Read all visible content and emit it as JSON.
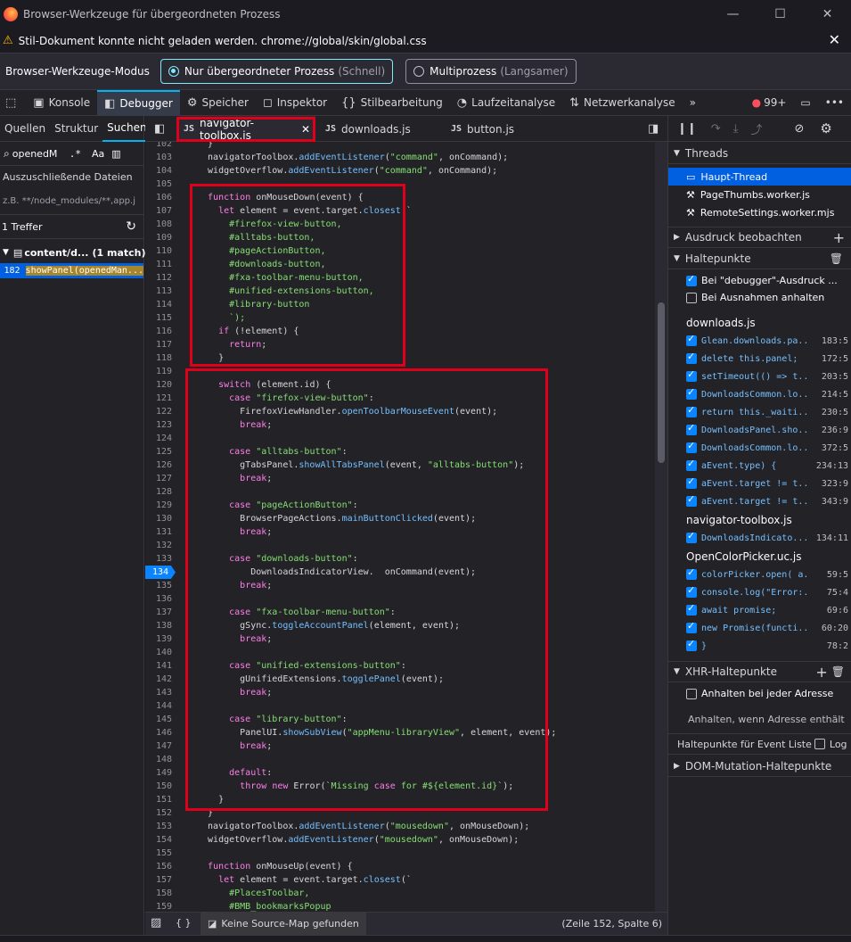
{
  "window": {
    "title": "Browser-Werkzeuge für übergeordneten Prozess",
    "minimize": "—",
    "maximize": "☐",
    "close": "✕"
  },
  "notification": {
    "text": "Stil-Dokument konnte nicht geladen werden. chrome://global/skin/global.css",
    "close": "✕"
  },
  "mode": {
    "label": "Browser-Werkzeuge-Modus",
    "option1": "Nur übergeordneter Prozess",
    "option1_hint": "(Schnell)",
    "option2": "Multiprozess",
    "option2_hint": "(Langsamer)"
  },
  "toolbox": {
    "tabs": [
      "Konsole",
      "Debugger",
      "Speicher",
      "Inspektor",
      "Stilbearbeitung",
      "Laufzeitanalyse",
      "Netzwerkanalyse"
    ],
    "more": "»",
    "errors": "99+",
    "menu": "•••"
  },
  "left": {
    "tabs": [
      "Quellen",
      "Struktur",
      "Suchen"
    ],
    "search_value": "openedM",
    "regex": ".*",
    "case": "Aa",
    "excluded_label": "Auszuschließende Dateien",
    "excluded_placeholder": "z.B. **/node_modules/**,app.j",
    "hits": "1 Treffer",
    "result_file": "content/d...",
    "result_match": "(1 match)",
    "result_line": "182",
    "result_text": "showPanel(openedMan..."
  },
  "editor": {
    "tabs": [
      "navigator-toolbox.js",
      "downloads.js",
      "button.js"
    ],
    "js_badge": "JS",
    "tab_close": "✕",
    "current_line": "134",
    "lines": [
      {
        "n": "102",
        "t": "  }"
      },
      {
        "n": "103",
        "t": "  navigatorToolbox.addEventListener(\"command\", onCommand);"
      },
      {
        "n": "104",
        "t": "  widgetOverflow.addEventListener(\"command\", onCommand);"
      },
      {
        "n": "105",
        "t": ""
      },
      {
        "n": "106",
        "t": "  function onMouseDown(event) {"
      },
      {
        "n": "107",
        "t": "    let element = event.target.closest(`"
      },
      {
        "n": "108",
        "t": "      #firefox-view-button,"
      },
      {
        "n": "109",
        "t": "      #alltabs-button,"
      },
      {
        "n": "110",
        "t": "      #pageActionButton,"
      },
      {
        "n": "111",
        "t": "      #downloads-button,"
      },
      {
        "n": "112",
        "t": "      #fxa-toolbar-menu-button,"
      },
      {
        "n": "113",
        "t": "      #unified-extensions-button,"
      },
      {
        "n": "114",
        "t": "      #library-button"
      },
      {
        "n": "115",
        "t": "      `);"
      },
      {
        "n": "116",
        "t": "    if (!element) {"
      },
      {
        "n": "117",
        "t": "      return;"
      },
      {
        "n": "118",
        "t": "    }"
      },
      {
        "n": "119",
        "t": ""
      },
      {
        "n": "120",
        "t": "    switch (element.id) {"
      },
      {
        "n": "121",
        "t": "      case \"firefox-view-button\":"
      },
      {
        "n": "122",
        "t": "        FirefoxViewHandler.openToolbarMouseEvent(event);"
      },
      {
        "n": "123",
        "t": "        break;"
      },
      {
        "n": "124",
        "t": ""
      },
      {
        "n": "125",
        "t": "      case \"alltabs-button\":"
      },
      {
        "n": "126",
        "t": "        gTabsPanel.showAllTabsPanel(event, \"alltabs-button\");"
      },
      {
        "n": "127",
        "t": "        break;"
      },
      {
        "n": "128",
        "t": ""
      },
      {
        "n": "129",
        "t": "      case \"pageActionButton\":"
      },
      {
        "n": "130",
        "t": "        BrowserPageActions.mainButtonClicked(event);"
      },
      {
        "n": "131",
        "t": "        break;"
      },
      {
        "n": "132",
        "t": ""
      },
      {
        "n": "133",
        "t": "      case \"downloads-button\":"
      },
      {
        "n": "134",
        "t": "          DownloadsIndicatorView.  onCommand(event);"
      },
      {
        "n": "135",
        "t": "        break;"
      },
      {
        "n": "136",
        "t": ""
      },
      {
        "n": "137",
        "t": "      case \"fxa-toolbar-menu-button\":"
      },
      {
        "n": "138",
        "t": "        gSync.toggleAccountPanel(element, event);"
      },
      {
        "n": "139",
        "t": "        break;"
      },
      {
        "n": "140",
        "t": ""
      },
      {
        "n": "141",
        "t": "      case \"unified-extensions-button\":"
      },
      {
        "n": "142",
        "t": "        gUnifiedExtensions.togglePanel(event);"
      },
      {
        "n": "143",
        "t": "        break;"
      },
      {
        "n": "144",
        "t": ""
      },
      {
        "n": "145",
        "t": "      case \"library-button\":"
      },
      {
        "n": "146",
        "t": "        PanelUI.showSubView(\"appMenu-libraryView\", element, event);"
      },
      {
        "n": "147",
        "t": "        break;"
      },
      {
        "n": "148",
        "t": ""
      },
      {
        "n": "149",
        "t": "      default:"
      },
      {
        "n": "150",
        "t": "        throw new Error(`Missing case for #${element.id}`);"
      },
      {
        "n": "151",
        "t": "    }"
      },
      {
        "n": "152",
        "t": "  }"
      },
      {
        "n": "153",
        "t": "  navigatorToolbox.addEventListener(\"mousedown\", onMouseDown);"
      },
      {
        "n": "154",
        "t": "  widgetOverflow.addEventListener(\"mousedown\", onMouseDown);"
      },
      {
        "n": "155",
        "t": ""
      },
      {
        "n": "156",
        "t": "  function onMouseUp(event) {"
      },
      {
        "n": "157",
        "t": "    let element = event.target.closest(`"
      },
      {
        "n": "158",
        "t": "      #PlacesToolbar,"
      },
      {
        "n": "159",
        "t": "      #BMB_bookmarksPopup"
      }
    ]
  },
  "status": {
    "braces": "{ }",
    "sourcemap": "Keine Source-Map gefunden",
    "position": "(Zeile 152, Spalte 6)"
  },
  "right": {
    "threads_label": "Threads",
    "threads": [
      "Haupt-Thread",
      "PageThumbs.worker.js",
      "RemoteSettings.worker.mjs"
    ],
    "watch_label": "Ausdruck beobachten",
    "bp_label": "Haltepunkte",
    "opt1": "Bei \"debugger\"-Ausdruck ...",
    "opt2": "Bei Ausnahmen anhalten",
    "groups": [
      {
        "file": "downloads.js",
        "items": [
          {
            "t": "Glean.downloads.pa...",
            "p": "183:5"
          },
          {
            "t": "delete this.panel;",
            "p": "172:5"
          },
          {
            "t": "setTimeout(() => t...",
            "p": "203:5"
          },
          {
            "t": "DownloadsCommon.lo...",
            "p": "214:5"
          },
          {
            "t": "return this._waiti...",
            "p": "230:5"
          },
          {
            "t": "DownloadsPanel.sho...",
            "p": "236:9"
          },
          {
            "t": "DownloadsCommon.lo...",
            "p": "372:5"
          },
          {
            "t": "aEvent.type) {",
            "p": "234:13"
          },
          {
            "t": "aEvent.target != t...",
            "p": "323:9"
          },
          {
            "t": "aEvent.target != t...",
            "p": "343:9"
          }
        ]
      },
      {
        "file": "navigator-toolbox.js",
        "items": [
          {
            "t": "DownloadsIndicato...",
            "p": "134:11"
          }
        ]
      },
      {
        "file": "OpenColorPicker.uc.js",
        "items": [
          {
            "t": "colorPicker.open( a...",
            "p": "59:5"
          },
          {
            "t": "console.log(\"Error:...",
            "p": "75:4"
          },
          {
            "t": "await promise;",
            "p": "69:6"
          },
          {
            "t": "new Promise(functi...",
            "p": "60:20"
          },
          {
            "t": "}",
            "p": "78:2"
          }
        ]
      }
    ],
    "xhr_label": "XHR-Haltepunkte",
    "xhr_opt": "Anhalten bei jeder Adresse",
    "xhr_hint": "Anhalten, wenn Adresse enthält",
    "event_label": "Haltepunkte für Event Liste",
    "event_log": "Log",
    "dom_label": "DOM-Mutation-Haltepunkte"
  }
}
